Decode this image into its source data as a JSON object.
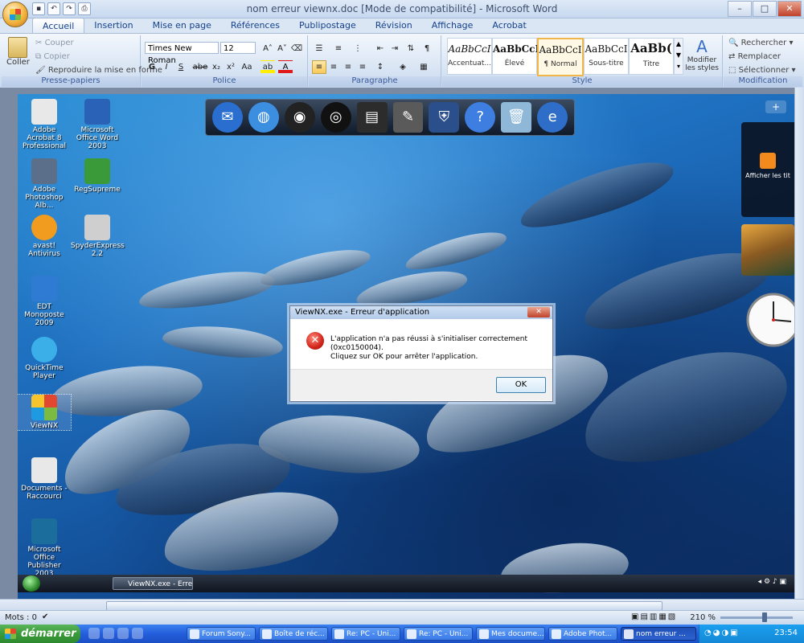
{
  "window": {
    "title": "nom erreur viewnx.doc [Mode de compatibilité] - Microsoft Word",
    "controls": {
      "minimize": "–",
      "maximize": "□",
      "close": "✕"
    }
  },
  "qat": [
    "save-icon",
    "undo-icon",
    "redo-icon",
    "print-icon"
  ],
  "tabs": [
    "Accueil",
    "Insertion",
    "Mise en page",
    "Références",
    "Publipostage",
    "Révision",
    "Affichage",
    "Acrobat"
  ],
  "ribbon": {
    "clipboard": {
      "paste": "Coller",
      "cut": "Couper",
      "copy": "Copier",
      "format_painter": "Reproduire la mise en forme",
      "label": "Presse-papiers"
    },
    "font": {
      "family": "Times New Roman",
      "size": "12",
      "label": "Police",
      "buttons": [
        "G",
        "I",
        "S",
        "abe",
        "x₂",
        "x²",
        "Aa"
      ]
    },
    "paragraph": {
      "label": "Paragraphe"
    },
    "styles": {
      "label": "Style",
      "items": [
        {
          "sample": "AaBbCcI",
          "name": "Accentuat..."
        },
        {
          "sample": "AaBbCcI",
          "name": "Élevé"
        },
        {
          "sample": "AaBbCcI",
          "name": "¶ Normal"
        },
        {
          "sample": "AaBbCcI",
          "name": "Sous-titre"
        },
        {
          "sample": "AaBb(",
          "name": "Titre"
        }
      ],
      "modify": "Modifier les styles"
    },
    "editing": {
      "label": "Modification",
      "find": "Rechercher",
      "replace": "Remplacer",
      "select": "Sélectionner"
    }
  },
  "desktop": {
    "icons": [
      {
        "label": "Adobe Acrobat 8 Professional",
        "color": "#d8d8d8"
      },
      {
        "label": "Microsoft Office Word 2003",
        "color": "#2a62b8"
      },
      {
        "label": "Adobe Photoshop Alb...",
        "color": "#5b6f8a"
      },
      {
        "label": "RegSupreme",
        "color": "#3a9a3a"
      },
      {
        "label": "avast! Antivirus",
        "color": "#f29c1f"
      },
      {
        "label": "SpyderExpress 2.2",
        "color": "#cfcfcf"
      },
      {
        "label": "EDT Monoposte 2009",
        "color": "#2f7bd4"
      },
      {
        "label": "QuickTime Player",
        "color": "#3bb0e8"
      },
      {
        "label": "ViewNX",
        "color": "#222222"
      },
      {
        "label": "Documents - Raccourci",
        "color": "#e8e8e8"
      },
      {
        "label": "Microsoft Office Publisher 2003",
        "color": "#1b6e9c"
      }
    ],
    "sidebar_feed": "Afficher les tit",
    "add": "+"
  },
  "dialog": {
    "title": "ViewNX.exe - Erreur d'application",
    "message_line1": "L'application n'a pas réussi à s'initialiser correctement (0xc0150004).",
    "message_line2": "Cliquez sur OK pour arrêter l'application.",
    "ok": "OK"
  },
  "inner_taskbar": {
    "task": "ViewNX.exe - Erreur ..."
  },
  "statusbar": {
    "words": "Mots : 0",
    "zoom": "210 %"
  },
  "xp_taskbar": {
    "start": "démarrer",
    "tasks": [
      "Forum Sony...",
      "Boîte de réc...",
      "Re: PC - Uni...",
      "Re: PC - Uni...",
      "Mes docume...",
      "Adobe Phot...",
      "nom erreur ..."
    ],
    "clock": "23:54"
  },
  "colors": {
    "accent": "#15428b",
    "error": "#d0241a"
  }
}
